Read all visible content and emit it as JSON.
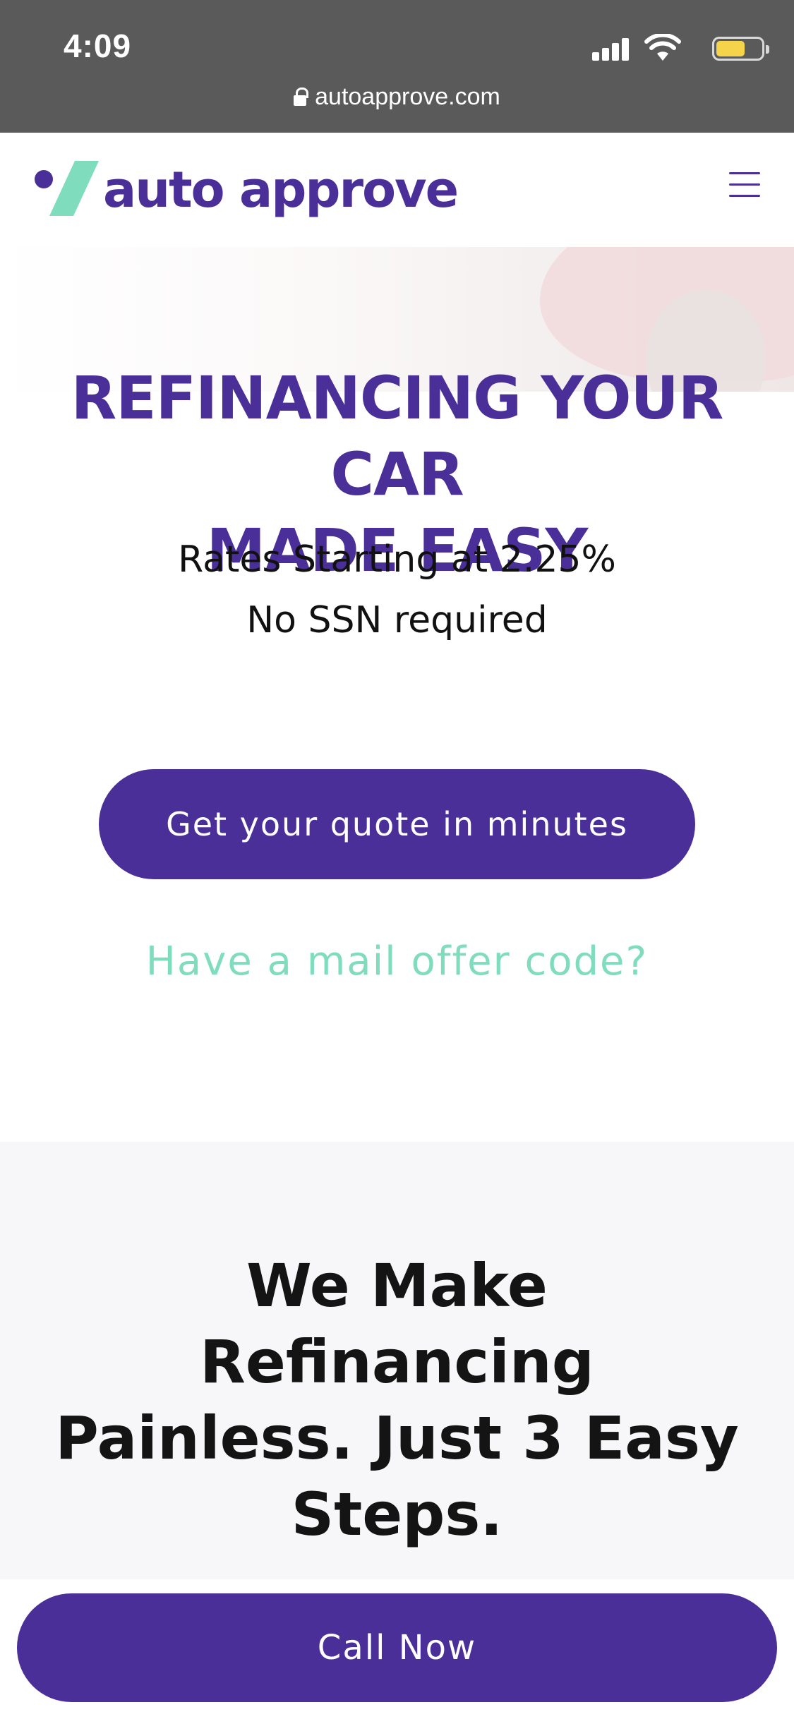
{
  "status_bar": {
    "time": "4:09",
    "url": "autoapprove.com",
    "battery_level": 0.65,
    "colors": {
      "background": "#5a5a5a",
      "battery": "#f5d34a"
    }
  },
  "header": {
    "logo_text": "auto approve",
    "menu_icon": "hamburger-menu-icon"
  },
  "hero": {
    "title_line1": "REFINANCING YOUR CAR",
    "title_line2": "MADE EASY",
    "subtitle_line1": "Rates Starting at 2.25%",
    "subtitle_line2": "No SSN required",
    "cta_label": "Get your quote in minutes",
    "offer_link": "Have a mail offer code?"
  },
  "steps": {
    "title": "We Make Refinancing Painless. Just 3 Easy Steps."
  },
  "call_bar": {
    "label": "Call Now"
  },
  "colors": {
    "brand_purple": "#4b2f98",
    "brand_mint": "#7fdcbd",
    "section_gray": "#f7f7f9"
  }
}
